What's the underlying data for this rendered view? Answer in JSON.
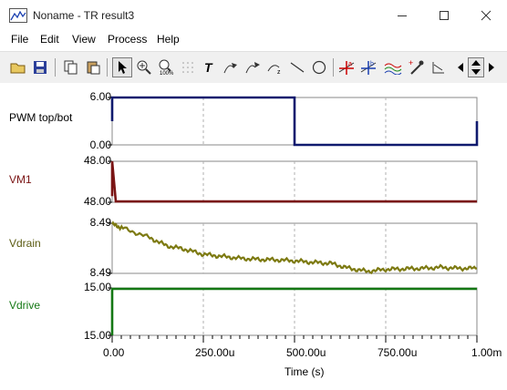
{
  "window": {
    "title": "Noname - TR result3",
    "controls": [
      "minimize",
      "maximize",
      "close"
    ]
  },
  "menu": {
    "items": [
      "File",
      "Edit",
      "View",
      "Process",
      "Help"
    ]
  },
  "toolbar": {
    "icons": [
      "open-folder-icon",
      "save-icon",
      "copy-icon",
      "paste-icon",
      "pointer-icon",
      "zoom-in-icon",
      "zoom-100-icon",
      "grid-icon",
      "text-tool-icon",
      "arrow-annotation-icon",
      "arrow-label-icon",
      "dimension-icon",
      "line-tool-icon",
      "ellipse-tool-icon",
      "cursor-a-icon",
      "cursor-b-icon",
      "curve-style-icon",
      "eyedropper-icon",
      "marker-icon",
      "scroll-left-icon",
      "scroll-updown-icon",
      "scroll-right-icon"
    ]
  },
  "colors": {
    "pwm": "#101a6e",
    "vm1": "#7a1414",
    "vdrain": "#7d7a12",
    "vdrive": "#147814",
    "grid": "#b0b0b0"
  },
  "chart_data": {
    "type": "line",
    "xlabel": "Time (s)",
    "x_ticks": [
      "0.00",
      "250.00u",
      "500.00u",
      "750.00u",
      "1.00m"
    ],
    "xlim": [
      0,
      0.001
    ],
    "series": [
      {
        "name": "PWM top/bot",
        "y_ticks": [
          "6.00",
          "0.00"
        ],
        "ylim": [
          0,
          6
        ],
        "x": [
          0,
          0,
          0.0005,
          0.0005,
          0.001,
          0.001
        ],
        "y": [
          3,
          6,
          6,
          0,
          0,
          3
        ]
      },
      {
        "name": "VM1",
        "y_ticks": [
          "48.00",
          "48.00"
        ],
        "ylim": [
          0,
          1
        ],
        "x": [
          0,
          0,
          1e-05,
          0.001
        ],
        "y": [
          0.15,
          1.0,
          0.02,
          0.02
        ]
      },
      {
        "name": "Vdrain",
        "y_ticks": [
          "8.49",
          "8.49"
        ],
        "ylim": [
          0,
          1
        ],
        "x": [
          0,
          3e-05,
          0.0001,
          0.00015,
          0.0002,
          0.00025,
          0.0003,
          0.00035,
          0.0004,
          0.00045,
          0.0005,
          0.00055,
          0.0006,
          0.00065,
          0.0007,
          0.00075,
          0.0008,
          0.00085,
          0.0009,
          0.00095,
          0.001
        ],
        "y": [
          0.98,
          0.9,
          0.72,
          0.55,
          0.48,
          0.38,
          0.34,
          0.3,
          0.28,
          0.27,
          0.25,
          0.22,
          0.2,
          0.1,
          0.04,
          0.08,
          0.09,
          0.1,
          0.12,
          0.1,
          0.1
        ]
      },
      {
        "name": "Vdrive",
        "y_ticks": [
          "15.00",
          "15.00"
        ],
        "ylim": [
          0,
          1
        ],
        "x": [
          0,
          0,
          0.001
        ],
        "y": [
          0.0,
          0.98,
          0.98
        ]
      }
    ]
  }
}
